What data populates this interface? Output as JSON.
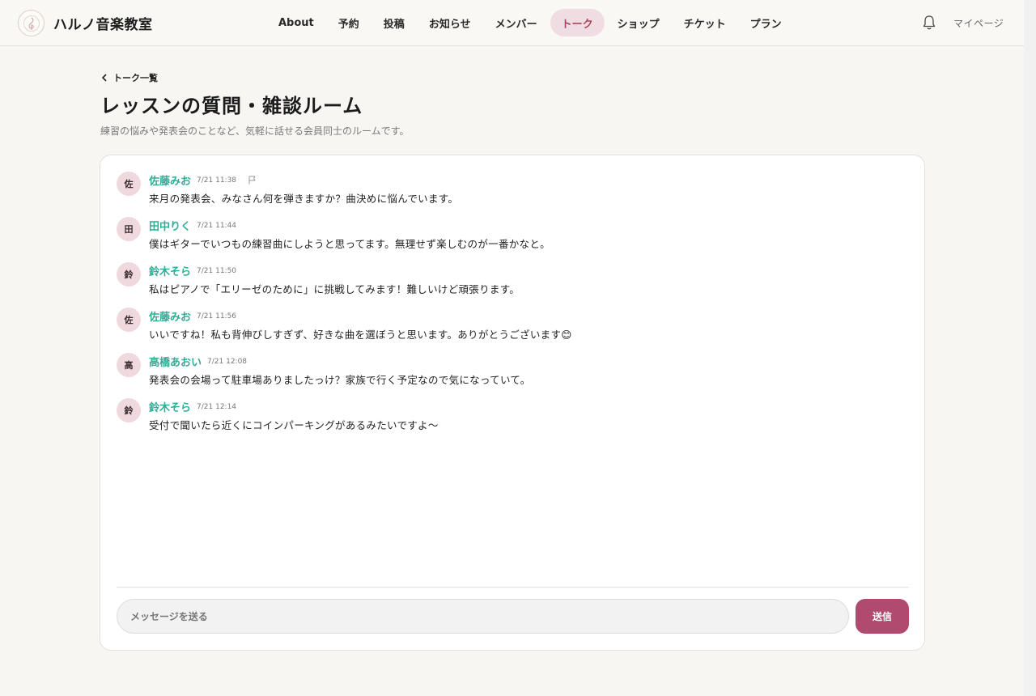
{
  "app": {
    "name": "ハルノ音楽教室",
    "logo_icon": "treble-clef-icon"
  },
  "nav": {
    "items": [
      {
        "label": "About",
        "active": false
      },
      {
        "label": "予約",
        "active": false
      },
      {
        "label": "投稿",
        "active": false
      },
      {
        "label": "お知らせ",
        "active": false
      },
      {
        "label": "メンバー",
        "active": false
      },
      {
        "label": "トーク",
        "active": true
      },
      {
        "label": "ショップ",
        "active": false
      },
      {
        "label": "チケット",
        "active": false
      },
      {
        "label": "プラン",
        "active": false
      }
    ],
    "notifications_icon": "bell-icon",
    "mypage_label": "マイページ"
  },
  "page": {
    "back_label": "トーク一覧",
    "title": "レッスンの質問・雑談ルーム",
    "description": "練習の悩みや発表会のことなど、気軽に話せる会員同士のルームです。"
  },
  "messages": [
    {
      "avatar": "佐",
      "name": "佐藤みお",
      "time": "7/21 11:38",
      "text": "来月の発表会、みなさん何を弾きますか？曲決めに悩んでいます。",
      "flag_icon": "flag-icon"
    },
    {
      "avatar": "田",
      "name": "田中りく",
      "time": "7/21 11:44",
      "text": "僕はギターでいつもの練習曲にしようと思ってます。無理せず楽しむのが一番かなと。"
    },
    {
      "avatar": "鈴",
      "name": "鈴木そら",
      "time": "7/21 11:50",
      "text": "私はピアノで「エリーゼのために」に挑戦してみます！難しいけど頑張ります。"
    },
    {
      "avatar": "佐",
      "name": "佐藤みお",
      "time": "7/21 11:56",
      "text": "いいですね！私も背伸びしすぎず、好きな曲を選ぼうと思います。ありがとうございます😊"
    },
    {
      "avatar": "高",
      "name": "高橋あおい",
      "time": "7/21 12:08",
      "text": "発表会の会場って駐車場ありましたっけ？家族で行く予定なので気になっていて。"
    },
    {
      "avatar": "鈴",
      "name": "鈴木そら",
      "time": "7/21 12:14",
      "text": "受付で聞いたら近くにコインパーキングがあるみたいですよ〜"
    }
  ],
  "composer": {
    "placeholder": "メッセージを送る",
    "value": "",
    "send_label": "送信"
  },
  "colors": {
    "accent": "#b04a6e",
    "active_nav_bg": "#f0dde3",
    "name_color": "#2fae97",
    "avatar_bg": "#efd9df"
  }
}
